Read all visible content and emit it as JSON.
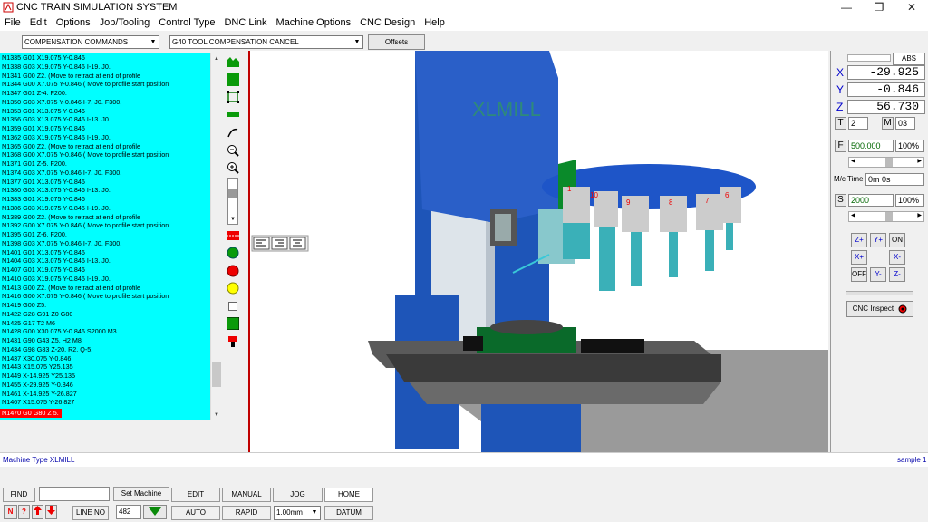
{
  "window": {
    "title": "CNC TRAIN SIMULATION SYSTEM",
    "minimize": "—",
    "restore": "❐",
    "close": "✕"
  },
  "menu": [
    "File",
    "Edit",
    "Options",
    "Job/Tooling",
    "Control Type",
    "DNC Link",
    "Machine Options",
    "CNC Design",
    "Help"
  ],
  "toolbar": {
    "category": "COMPENSATION COMMANDS",
    "command": "G40 TOOL COMPENSATION CANCEL",
    "offsets_label": "Offsets"
  },
  "code_lines": [
    "N1335 G01 X19.075 Y-0.846",
    "N1338 G03 X19.075 Y-0.846  I-19. J0.",
    "N1341 G00 Z2. (Move to retract at end of profile",
    "N1344 G00 X7.075 Y-0.846  ( Move to profile start position",
    "N1347 G01 Z-4. F200.",
    "N1350 G03 X7.075 Y-0.846  I-7. J0. F300.",
    "N1353 G01 X13.075 Y-0.846",
    "N1356 G03 X13.075 Y-0.846  I-13. J0.",
    "N1359 G01 X19.075 Y-0.846",
    "N1362 G03 X19.075 Y-0.846  I-19. J0.",
    "N1365 G00 Z2. (Move to retract at end of profile",
    "N1368 G00 X7.075 Y-0.846  ( Move to profile start position",
    "N1371 G01 Z-5. F200.",
    "N1374 G03 X7.075 Y-0.846  I-7. J0. F300.",
    "N1377 G01 X13.075 Y-0.846",
    "N1380 G03 X13.075 Y-0.846  I-13. J0.",
    "N1383 G01 X19.075 Y-0.846",
    "N1386 G03 X19.075 Y-0.846  I-19. J0.",
    "N1389 G00 Z2. (Move to retract at end of profile",
    "N1392 G00 X7.075 Y-0.846  ( Move to profile start position",
    "N1395 G01 Z-6. F200.",
    "N1398 G03 X7.075 Y-0.846  I-7. J0. F300.",
    "N1401 G01 X13.075 Y-0.846",
    "N1404 G03 X13.075 Y-0.846  I-13. J0.",
    "N1407 G01 X19.075 Y-0.846",
    "N1410 G03 X19.075 Y-0.846  I-19. J0.",
    "N1413 G00 Z2. (Move to retract at end of profile",
    "N1416 G00 X7.075 Y-0.846  ( Move to profile start position",
    "N1419 G00 Z5.",
    "N1422 G28 G91 Z0 G80",
    "N1425 G17 T2 M6",
    "N1428 G00 X30.075 Y-0.846 S2000 M3",
    "N1431 G90 G43 Z5. H2 M8",
    "N1434 G98 G83   Z-20. R2. Q-5.",
    "N1437  X30.075 Y-0.846",
    "N1443  X15.075 Y25.135",
    "N1449  X-14.925 Y25.135",
    "N1455  X-29.925 Y-0.846",
    "N1461  X-14.925 Y-26.827",
    "N1467  X15.075 Y-26.827",
    "N1470 G0 G80 Z 5.",
    "N1473 G28 G91 Z0 G80"
  ],
  "highlight_index": 40,
  "machine_label": "XLMILL",
  "turret_numbers": [
    "1",
    "10",
    "9",
    "8",
    "7",
    "6"
  ],
  "dro": {
    "mode": "ABS",
    "x_label": "X",
    "x": "-29.925",
    "y_label": "Y",
    "y": "-0.846",
    "z_label": "Z",
    "z": "56.730",
    "t_label": "T",
    "t": "2",
    "m_label": "M",
    "m": "03",
    "f_label": "F",
    "f": "500.000",
    "f_override": "100%",
    "mc_time_label": "M/c Time",
    "mc_time": "0m 0s",
    "s_label": "S",
    "s": "2000",
    "s_override": "100%"
  },
  "jog": {
    "z_plus": "Z+",
    "y_plus": "Y+",
    "on": "ON",
    "x_plus": "X+",
    "x_minus": "X-",
    "off": "OFF",
    "y_minus": "Y-",
    "z_minus": "Z-"
  },
  "inspect_label": "CNC Inspect",
  "status": {
    "machine_type": "Machine Type  XLMILL",
    "sample": "sample 1"
  },
  "bottom": {
    "find": "FIND",
    "set_machine": "Set Machine",
    "edit": "EDIT",
    "manual": "MANUAL",
    "jog": "JOG",
    "home": "HOME",
    "n_label": "N",
    "q_label": "?",
    "line_no": "LINE NO",
    "line_value": "482",
    "auto": "AUTO",
    "rapid": "RAPID",
    "step": "1.00mm",
    "datum": "DATUM"
  }
}
